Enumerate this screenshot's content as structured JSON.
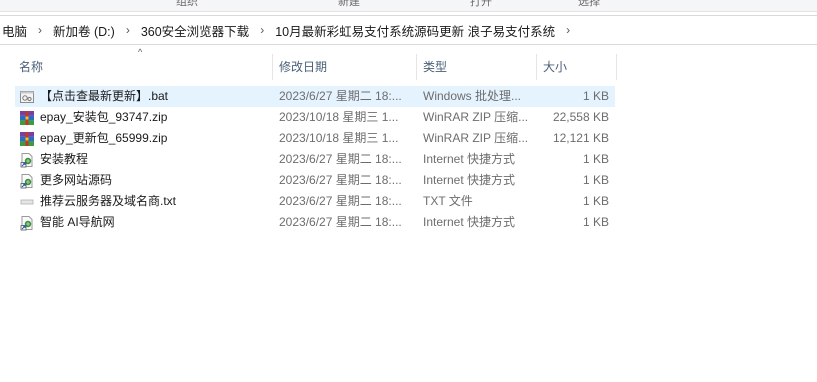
{
  "ribbon": {
    "labels": [
      "组织",
      "新建",
      "打开",
      "选择"
    ]
  },
  "breadcrumb": [
    "电脑",
    "新加卷 (D:)",
    "360安全浏览器下载",
    "10月最新彩虹易支付系统源码更新 浪子易支付系统"
  ],
  "columns": {
    "name": "名称",
    "date": "修改日期",
    "type": "类型",
    "size": "大小"
  },
  "files": [
    {
      "name": "【点击查最新更新】.bat",
      "date": "2023/6/27 星期二 18:...",
      "type": "Windows 批处理...",
      "size": "1 KB",
      "icon": "bat-file-icon"
    },
    {
      "name": "epay_安装包_93747.zip",
      "date": "2023/10/18 星期三 1...",
      "type": "WinRAR ZIP 压缩...",
      "size": "22,558 KB",
      "icon": "winrar-zip-icon"
    },
    {
      "name": "epay_更新包_65999.zip",
      "date": "2023/10/18 星期三 1...",
      "type": "WinRAR ZIP 压缩...",
      "size": "12,121 KB",
      "icon": "winrar-zip-icon"
    },
    {
      "name": "安装教程",
      "date": "2023/6/27 星期二 18:...",
      "type": "Internet 快捷方式",
      "size": "1 KB",
      "icon": "internet-shortcut-icon"
    },
    {
      "name": "更多网站源码",
      "date": "2023/6/27 星期二 18:...",
      "type": "Internet 快捷方式",
      "size": "1 KB",
      "icon": "internet-shortcut-icon"
    },
    {
      "name": "推荐云服务器及域名商.txt",
      "date": "2023/6/27 星期二 18:...",
      "type": "TXT 文件",
      "size": "1 KB",
      "icon": "text-file-icon"
    },
    {
      "name": "智能 AI导航网",
      "date": "2023/6/27 星期二 18:...",
      "type": "Internet 快捷方式",
      "size": "1 KB",
      "icon": "internet-shortcut-icon"
    }
  ],
  "colors": {
    "selected_row": "#e5f3ff",
    "header_text": "#4c607a",
    "secondary_text": "#6d6d6d"
  }
}
